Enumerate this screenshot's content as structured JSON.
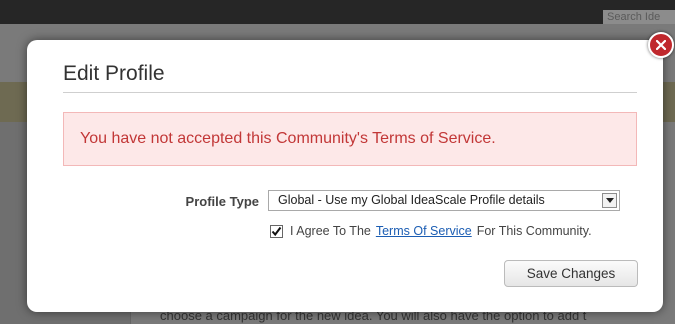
{
  "background": {
    "search_placeholder": "Search Ide",
    "bottom_text": "choose a campaign for the new idea. You will also have the option to add t"
  },
  "modal": {
    "title": "Edit Profile",
    "alert": "You have not accepted this Community's Terms of Service.",
    "profile_type_label": "Profile Type",
    "profile_type_value": "Global - Use my Global IdeaScale Profile details",
    "agree": {
      "checked": true,
      "prefix": "I Agree To The",
      "link": "Terms Of Service",
      "suffix": "For This Community."
    },
    "save_label": "Save Changes"
  },
  "colors": {
    "alert_bg": "#fde8e8",
    "alert_text": "#c23737",
    "close_button": "#c0282d",
    "link": "#1b5db3"
  },
  "icons": {
    "close": "close-icon",
    "dropdown": "chevron-down-icon",
    "check": "checkmark-icon"
  }
}
